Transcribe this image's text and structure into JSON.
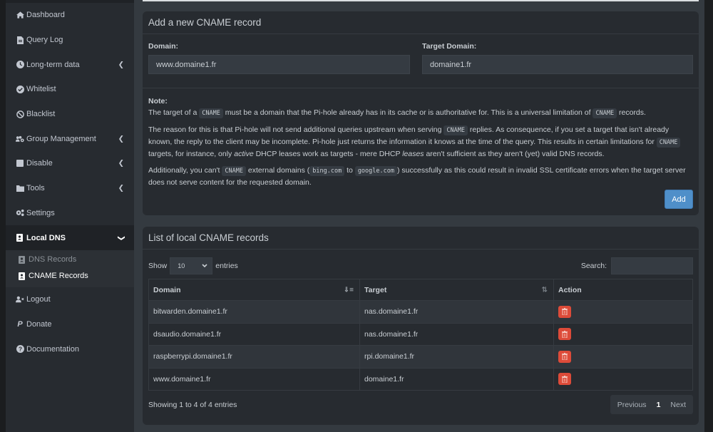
{
  "sidebar": {
    "items": [
      {
        "label": "Dashboard",
        "icon": "home-icon"
      },
      {
        "label": "Query Log",
        "icon": "file-icon"
      },
      {
        "label": "Long-term data",
        "icon": "clock-icon",
        "has_children": true
      },
      {
        "label": "Whitelist",
        "icon": "check-circle-icon"
      },
      {
        "label": "Blacklist",
        "icon": "ban-icon"
      },
      {
        "label": "Group Management",
        "icon": "users-cog-icon",
        "has_children": true
      },
      {
        "label": "Disable",
        "icon": "stop-icon",
        "has_children": true
      },
      {
        "label": "Tools",
        "icon": "folder-icon",
        "has_children": true
      },
      {
        "label": "Settings",
        "icon": "cogs-icon"
      },
      {
        "label": "Local DNS",
        "icon": "address-book-icon",
        "open": true
      }
    ],
    "submenu": [
      {
        "label": "DNS Records",
        "icon": "address-book-icon",
        "active": false
      },
      {
        "label": "CNAME Records",
        "icon": "address-book-icon",
        "active": true
      }
    ],
    "bottom_items": [
      {
        "label": "Logout",
        "icon": "user-times-icon"
      },
      {
        "label": "Donate",
        "icon": "paypal-icon"
      },
      {
        "label": "Documentation",
        "icon": "question-circle-icon"
      }
    ]
  },
  "add_box": {
    "title": "Add a new CNAME record",
    "domain_label": "Domain:",
    "domain_value": "www.domaine1.fr",
    "target_label": "Target Domain:",
    "target_value": "domaine1.fr",
    "note_title": "Note:",
    "note_p1_a": "The target of a ",
    "note_p1_code": "CNAME",
    "note_p1_b": " must be a domain that the Pi-hole already has in its cache or is authoritative for. This is a universal limitation of ",
    "note_p1_code2": "CNAME",
    "note_p1_c": " records.",
    "note_p2_a": "The reason for this is that Pi-hole will not send additional queries upstream when serving ",
    "note_p2_code": "CNAME",
    "note_p2_b": " replies. As consequence, if you set a target that isn't already known, the reply to the client may be incomplete. Pi-hole just returns the information it knows at the time of the query. This results in certain limitations for ",
    "note_p2_code2": "CNAME",
    "note_p2_c": " targets, for instance, only ",
    "note_p2_em": "active",
    "note_p2_d": " DHCP leases work as targets - mere DHCP ",
    "note_p2_em2": "leases",
    "note_p2_e": " aren't sufficient as they aren't (yet) valid DNS records.",
    "note_p3_a": "Additionally, you can't ",
    "note_p3_code": "CNAME",
    "note_p3_b": " external domains (",
    "note_p3_code2": "bing.com",
    "note_p3_c": " to ",
    "note_p3_code3": "google.com",
    "note_p3_d": ") successfully as this could result in invalid SSL certificate errors when the target server does not serve content for the requested domain.",
    "add_button": "Add"
  },
  "list_box": {
    "title": "List of local CNAME records",
    "show_label": "Show",
    "entries_label": "entries",
    "page_size": "10",
    "search_label": "Search:",
    "search_value": "",
    "columns": [
      "Domain",
      "Target",
      "Action"
    ],
    "rows": [
      {
        "domain": "bitwarden.domaine1.fr",
        "target": "nas.domaine1.fr"
      },
      {
        "domain": "dsaudio.domaine1.fr",
        "target": "nas.domaine1.fr"
      },
      {
        "domain": "raspberrypi.domaine1.fr",
        "target": "rpi.domaine1.fr"
      },
      {
        "domain": "www.domaine1.fr",
        "target": "domaine1.fr"
      }
    ],
    "info": "Showing 1 to 4 of 4 entries",
    "pagination": {
      "previous": "Previous",
      "current": "1",
      "next": "Next"
    }
  },
  "colors": {
    "add_button": "#4f8fc9",
    "delete_button": "#dd4b39",
    "sidebar_bg": "#272b30",
    "content_bg": "#343a40"
  }
}
